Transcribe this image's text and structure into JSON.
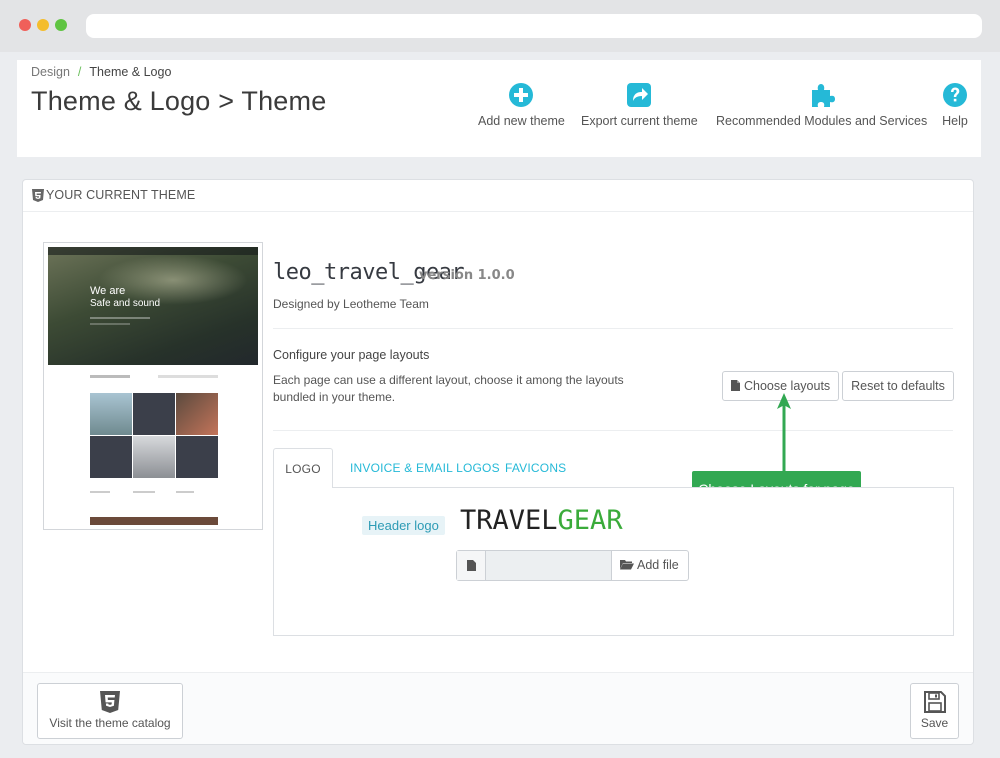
{
  "breadcrumb": {
    "parent": "Design",
    "separator": "/",
    "current": "Theme & Logo"
  },
  "page_title": "Theme & Logo > Theme",
  "toolbar": {
    "add_theme": "Add new theme",
    "export_theme": "Export current theme",
    "recommended_modules": "Recommended Modules and Services",
    "help": "Help"
  },
  "panel": {
    "heading": "YOUR CURRENT THEME"
  },
  "preview": {
    "hero_line1": "We are",
    "hero_line2": "Safe and sound"
  },
  "theme": {
    "name": "leo_travel_gear",
    "version": "version 1.0.0",
    "designed_by": "Designed by Leotheme Team"
  },
  "layouts": {
    "title": "Configure your page layouts",
    "description": "Each page can use a different layout, choose it among the layouts bundled in your theme.",
    "choose_button": "Choose layouts",
    "reset_button": "Reset to defaults"
  },
  "annotation": {
    "tooltip": "Choose Layouts for page",
    "color": "#32a852"
  },
  "tabs": [
    {
      "label": "LOGO",
      "active": true
    },
    {
      "label": "INVOICE & EMAIL LOGOS",
      "active": false
    },
    {
      "label": "FAVICONS",
      "active": false
    }
  ],
  "logo_tab": {
    "header_logo_label": "Header logo",
    "logo_text_part1": "TRAVEL",
    "logo_text_part2": "GEAR",
    "add_file_button": "Add file"
  },
  "footer": {
    "catalog_button": "Visit the theme catalog",
    "save_button": "Save"
  },
  "colors": {
    "accent": "#25b9d7",
    "success": "#32a852"
  }
}
